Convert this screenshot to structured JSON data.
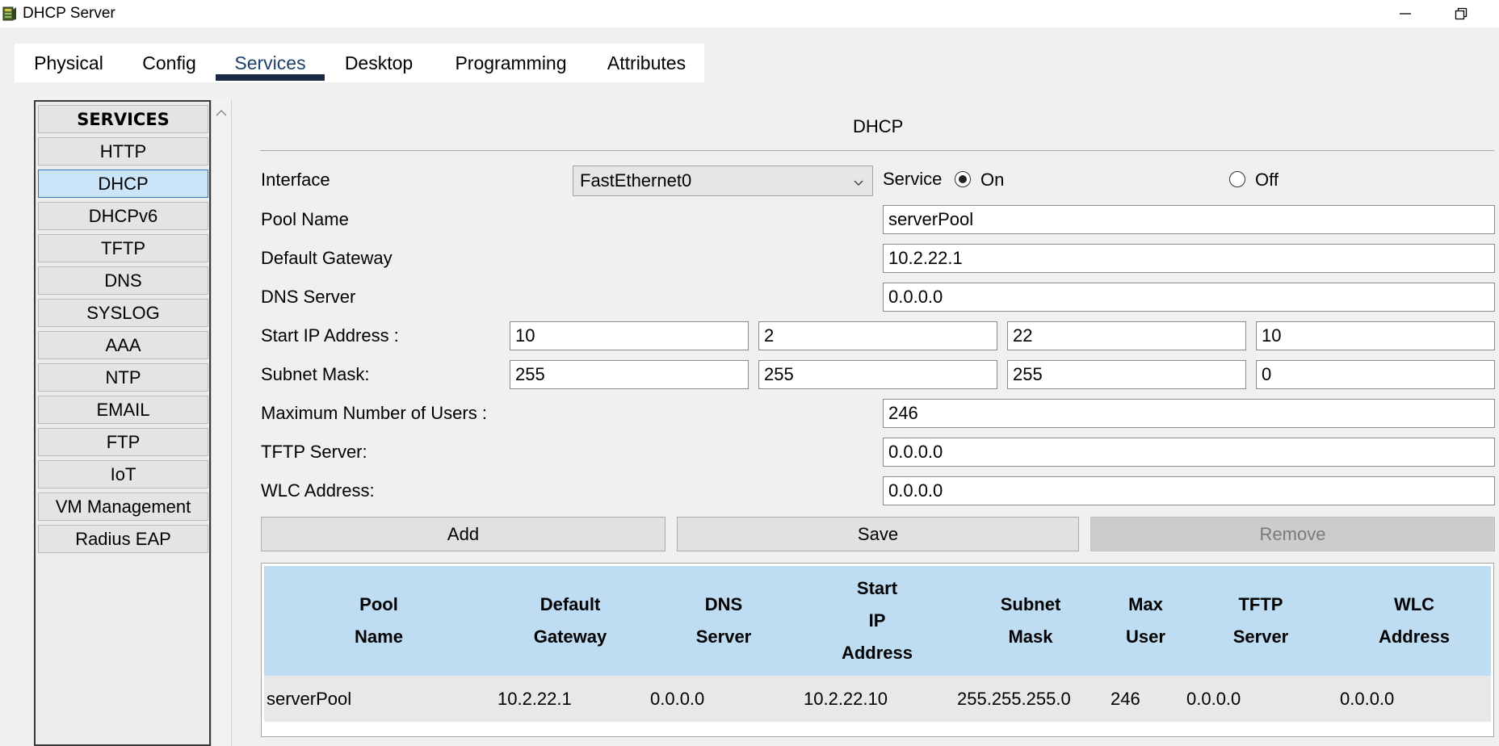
{
  "window": {
    "title": "DHCP Server",
    "minimize_glyph": "—",
    "maximize_glyph": "❐"
  },
  "tabs": [
    {
      "label": "Physical"
    },
    {
      "label": "Config"
    },
    {
      "label": "Services",
      "active": true
    },
    {
      "label": "Desktop"
    },
    {
      "label": "Programming"
    },
    {
      "label": "Attributes"
    }
  ],
  "sidebar": {
    "header": "SERVICES",
    "items": [
      {
        "label": "HTTP"
      },
      {
        "label": "DHCP",
        "selected": true
      },
      {
        "label": "DHCPv6"
      },
      {
        "label": "TFTP"
      },
      {
        "label": "DNS"
      },
      {
        "label": "SYSLOG"
      },
      {
        "label": "AAA"
      },
      {
        "label": "NTP"
      },
      {
        "label": "EMAIL"
      },
      {
        "label": "FTP"
      },
      {
        "label": "IoT"
      },
      {
        "label": "VM Management"
      },
      {
        "label": "Radius EAP"
      }
    ]
  },
  "dhcp": {
    "title": "DHCP",
    "interface_label": "Interface",
    "interface_value": "FastEthernet0",
    "service_label": "Service",
    "service_on": "On",
    "service_off": "Off",
    "service_state": "On",
    "pool_name_label": "Pool Name",
    "pool_name": "serverPool",
    "default_gateway_label": "Default Gateway",
    "default_gateway": "10.2.22.1",
    "dns_server_label": "DNS Server",
    "dns_server": "0.0.0.0",
    "start_ip_label": "Start IP Address :",
    "start_ip": [
      "10",
      "2",
      "22",
      "10"
    ],
    "subnet_mask_label": "Subnet Mask:",
    "subnet_mask": [
      "255",
      "255",
      "255",
      "0"
    ],
    "max_users_label": "Maximum Number of Users :",
    "max_users": "246",
    "tftp_server_label": "TFTP Server:",
    "tftp_server": "0.0.0.0",
    "wlc_address_label": "WLC Address:",
    "wlc_address": "0.0.0.0"
  },
  "buttons": {
    "add": "Add",
    "save": "Save",
    "remove": "Remove"
  },
  "table": {
    "columns": [
      "Pool\nName",
      "Default\nGateway",
      "DNS\nServer",
      "Start\nIP\nAddress",
      "Subnet\nMask",
      "Max\nUser",
      "TFTP\nServer",
      "WLC\nAddress"
    ],
    "rows": [
      [
        "serverPool",
        "10.2.22.1",
        "0.0.0.0",
        "10.2.22.10",
        "255.255.255.0",
        "246",
        "0.0.0.0",
        "0.0.0.0"
      ]
    ]
  },
  "icons": {
    "app": "packet-tracer-server-icon",
    "scroll_up": "chevron-up-icon",
    "select": "chevron-down-icon"
  },
  "colors": {
    "selected_item": "#cce4f7",
    "tab_underline": "#1a2a45",
    "table_header": "#bedcf2"
  }
}
